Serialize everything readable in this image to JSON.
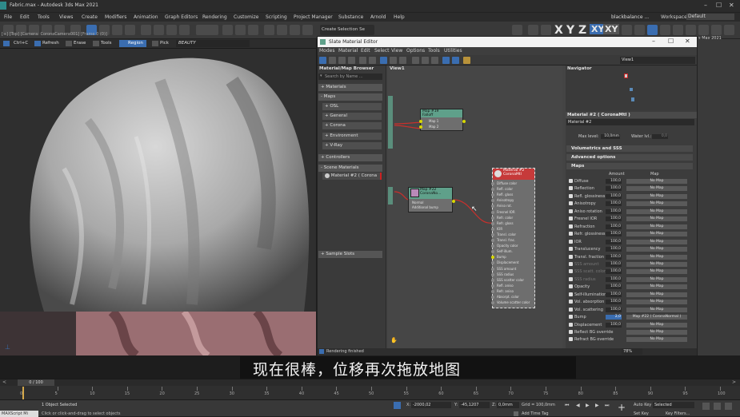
{
  "app": {
    "title": "Fabric.max - Autodesk 3ds Max 2021"
  },
  "menu": [
    "File",
    "Edit",
    "Tools",
    "Views",
    "Create",
    "Modifiers",
    "Animation",
    "Graph Editors",
    "Rendering",
    "Customize",
    "Scripting",
    "Project Manager",
    "Substance",
    "Arnold",
    "Help"
  ],
  "toolbar": {
    "user": "blackbalance ...",
    "workspaces_label": "Workspaces:",
    "workspace": "Default",
    "selection_set": "Create Selection Se",
    "axes": [
      "X",
      "Y",
      "Z",
      "XY",
      "XY"
    ],
    "max_badge": "s Max 2021"
  },
  "viewport": {
    "label": "[+] [Top] [Camera: CoronaCamera001] [Frame 0 (0)]",
    "tools": [
      "Ctrl+C",
      "Refresh",
      "Erase",
      "Tools",
      "Region",
      "Pick"
    ],
    "render_mode": "BEAUTY"
  },
  "sme": {
    "title": "Slate Material Editor",
    "menu": [
      "Modes",
      "Material",
      "Edit",
      "Select",
      "View",
      "Options",
      "Tools",
      "Utilities"
    ],
    "view_dropdown": "View1",
    "browser": {
      "title": "Material/Map Browser",
      "search": "Search by Name ...",
      "groups": [
        "+ Materials",
        "- Maps",
        "+ Controllers",
        "- Scene Materials",
        "+ Sample Slots"
      ],
      "map_items": [
        "+ OSL",
        "+ General",
        "+ Corona",
        "+ Environment",
        "+ V-Ray"
      ],
      "scene_material": "Material #2  ( Corona"
    },
    "view_tab": "View1",
    "nodes": {
      "falloff": {
        "title": "Map #19\nFalloff",
        "rows": [
          "Map 1",
          "Map 2"
        ]
      },
      "normal": {
        "title": "Map #22\nCoronaNo...",
        "rows": [
          "Normal",
          "Additional bump"
        ]
      },
      "material": {
        "title": "Material #2\nCoronaMtl",
        "rows": [
          "Diffuse color",
          "Refl. color",
          "Refl. gloss",
          "Anisotropy",
          "Aniso rot.",
          "Fresnel IOR",
          "Refr. color",
          "Refr. gloss",
          "IOR",
          "Transl. color",
          "Transl. frac.",
          "Opacity color",
          "Self-illum.",
          "Bump",
          "Displacement",
          "SSS amount",
          "SSS radius",
          "SSS scatter color",
          "Refl. aniso",
          "Refr. aniso",
          "Absorpt. color",
          "Volume scatter color"
        ]
      }
    },
    "navigator": {
      "title": "Navigator"
    },
    "props": {
      "title": "Material #2  ( CoronaMtl )",
      "name": "Material #2",
      "max_level_label": "Max level:",
      "max_level": "10,0mm",
      "water_label": "Water lvl.:",
      "water": "0,0",
      "rollouts": [
        "Volumetrics and SSS",
        "Advanced options",
        "Maps"
      ],
      "col_amount": "Amount",
      "col_map": "Map",
      "maps": [
        {
          "label": "Diffuse",
          "amount": "100,0",
          "map": "No Map"
        },
        {
          "label": "Reflection",
          "amount": "100,0",
          "map": "No Map"
        },
        {
          "label": "Refl. glossiness",
          "amount": "100,0",
          "map": "No Map"
        },
        {
          "label": "Anisotropy",
          "amount": "100,0",
          "map": "No Map"
        },
        {
          "label": "Aniso rotation",
          "amount": "100,0",
          "map": "No Map"
        },
        {
          "label": "Fresnel IOR",
          "amount": "100,0",
          "map": "No Map"
        },
        {
          "label": "Refraction",
          "amount": "100,0",
          "map": "No Map"
        },
        {
          "label": "Refr. glossiness",
          "amount": "100,0",
          "map": "No Map"
        },
        {
          "label": "IOR",
          "amount": "100,0",
          "map": "No Map"
        },
        {
          "label": "Translucency",
          "amount": "100,0",
          "map": "No Map"
        },
        {
          "label": "Transl. fraction",
          "amount": "100,0",
          "map": "No Map"
        },
        {
          "label": "SSS amount",
          "amount": "100,0",
          "map": "No Map"
        },
        {
          "label": "SSS scatt. color",
          "amount": "100,0",
          "map": "No Map"
        },
        {
          "label": "SSS radius",
          "amount": "100,0",
          "map": "No Map"
        },
        {
          "label": "Opacity",
          "amount": "100,0",
          "map": "No Map"
        },
        {
          "label": "Self-illumination",
          "amount": "100,0",
          "map": "No Map"
        },
        {
          "label": "Vol. absorption",
          "amount": "100,0",
          "map": "No Map"
        },
        {
          "label": "Vol. scattering",
          "amount": "100,0",
          "map": "No Map"
        },
        {
          "label": "Bump",
          "amount": "2,0",
          "map": "Map #22  ( CoronaNormal )"
        },
        {
          "label": "Displacement",
          "amount": "100,0",
          "map": "No Map"
        },
        {
          "label": "Reflect BG override",
          "amount": "",
          "map": "No Map"
        },
        {
          "label": "Refract BG override",
          "amount": "",
          "map": "No Map"
        }
      ]
    },
    "status": "Rendering finished",
    "zoom": "78%"
  },
  "subtitle": "现在很棒，位移再次拖放地图",
  "timeline": {
    "frame": "0 / 100",
    "ticks": [
      "0",
      "5",
      "10",
      "15",
      "20",
      "25",
      "30",
      "35",
      "40",
      "45",
      "50",
      "55",
      "60",
      "65",
      "70",
      "75",
      "80",
      "85",
      "90",
      "95",
      "100"
    ]
  },
  "status": {
    "script": "MAXScript Mi",
    "selected": "1 Object Selected",
    "hint": "Click or click-and-drag to select objects",
    "x_label": "X:",
    "x": "-2000,02",
    "y_label": "Y:",
    "y": "-45,1207",
    "z_label": "Z:",
    "z": "0,0mm",
    "grid": "Grid = 100,0mm",
    "add_time_tag": "Add Time Tag",
    "auto_key": "Auto Key",
    "set_key": "Set Key",
    "selected_dd": "Selected",
    "key_filters": "Key Filters..."
  }
}
